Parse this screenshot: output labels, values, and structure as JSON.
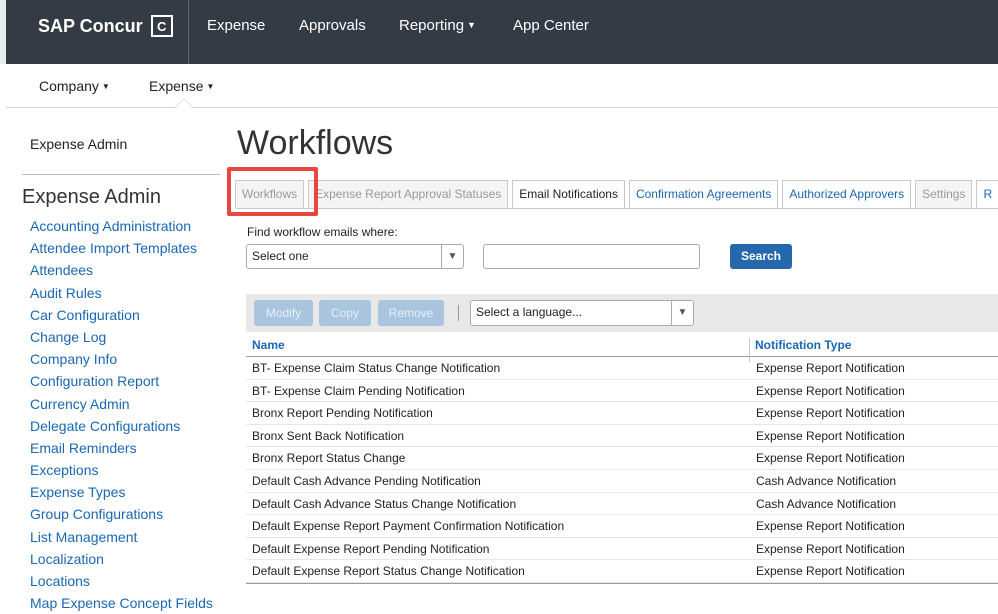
{
  "header": {
    "brand": "SAP Concur",
    "brand_logo_letter": "C",
    "nav": [
      {
        "label": "Expense"
      },
      {
        "label": "Approvals"
      },
      {
        "label": "Reporting",
        "dropdown": true
      },
      {
        "label": "App Center"
      }
    ]
  },
  "subnav": {
    "company": "Company",
    "expense": "Expense"
  },
  "sidebar": {
    "top_label": "Expense Admin",
    "heading": "Expense Admin",
    "items": [
      "Accounting Administration",
      "Attendee Import Templates",
      "Attendees",
      "Audit Rules",
      "Car Configuration",
      "Change Log",
      "Company Info",
      "Configuration Report",
      "Currency Admin",
      "Delegate Configurations",
      "Email Reminders",
      "Exceptions",
      "Expense Types",
      "Group Configurations",
      "List Management",
      "Localization",
      "Locations",
      "Map Expense Concept Fields"
    ]
  },
  "main": {
    "title": "Workflows",
    "tabs": [
      "Workflows",
      "Expense Report Approval Statuses",
      "Email Notifications",
      "Confirmation Agreements",
      "Authorized Approvers",
      "Settings",
      "R"
    ],
    "find_label": "Find workflow emails where:",
    "filter_select": "Select one",
    "search_button": "Search",
    "toolbar": {
      "modify": "Modify",
      "copy": "Copy",
      "remove": "Remove",
      "language_select": "Select a language..."
    },
    "table": {
      "headers": [
        "Name",
        "Notification Type"
      ],
      "rows": [
        [
          "BT- Expense Claim Status Change Notification",
          "Expense Report Notification"
        ],
        [
          "BT- Expense Claim Pending Notification",
          "Expense Report Notification"
        ],
        [
          "Bronx Report Pending Notification",
          "Expense Report Notification"
        ],
        [
          "Bronx Sent Back Notification",
          "Expense Report Notification"
        ],
        [
          "Bronx Report Status Change",
          "Expense Report Notification"
        ],
        [
          "Default Cash Advance Pending Notification",
          "Cash Advance Notification"
        ],
        [
          "Default Cash Advance Status Change Notification",
          "Cash Advance Notification"
        ],
        [
          "Default Expense Report Payment Confirmation Notification",
          "Expense Report Notification"
        ],
        [
          "Default Expense Report Pending Notification",
          "Expense Report Notification"
        ],
        [
          "Default Expense Report Status Change Notification",
          "Expense Report Notification"
        ]
      ]
    }
  },
  "colors": {
    "topbar": "#353b44",
    "link": "#1a67b3",
    "primary_button": "#2569ac",
    "highlight": "#e8473f",
    "disabled_button": "#a9c4df"
  }
}
